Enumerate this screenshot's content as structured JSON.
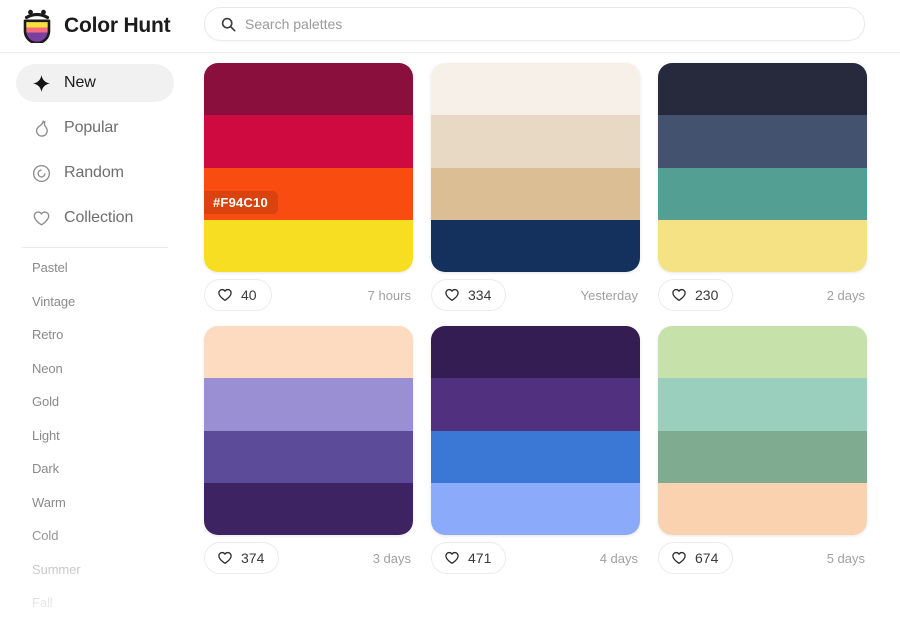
{
  "header": {
    "brand_name": "Color Hunt",
    "logo_icon": "colorhunt-logo-icon",
    "search": {
      "icon": "search-icon",
      "placeholder": "Search palettes",
      "value": ""
    }
  },
  "sidebar": {
    "nav": [
      {
        "label": "New",
        "icon": "sparkle-icon",
        "active": true
      },
      {
        "label": "Popular",
        "icon": "flame-icon",
        "active": false
      },
      {
        "label": "Random",
        "icon": "spiral-icon",
        "active": false
      },
      {
        "label": "Collection",
        "icon": "heart-icon",
        "active": false
      }
    ],
    "tags": [
      {
        "label": "Pastel"
      },
      {
        "label": "Vintage"
      },
      {
        "label": "Retro"
      },
      {
        "label": "Neon"
      },
      {
        "label": "Gold"
      },
      {
        "label": "Light"
      },
      {
        "label": "Dark"
      },
      {
        "label": "Warm"
      },
      {
        "label": "Cold"
      },
      {
        "label": "Summer"
      },
      {
        "label": "Fall"
      }
    ]
  },
  "palettes": [
    {
      "colors": [
        "#8A0F3C",
        "#CE0A41",
        "#F94C10",
        "#F8DE22"
      ],
      "hex_label": "#F94C10",
      "hex_label_band": 2,
      "likes": "40",
      "timestamp": "7 hours"
    },
    {
      "colors": [
        "#F7F0E8",
        "#E8D9C5",
        "#DCBE95",
        "#13315C"
      ],
      "hex_label": null,
      "hex_label_band": -1,
      "likes": "334",
      "timestamp": "Yesterday"
    },
    {
      "colors": [
        "#27293D",
        "#43526E",
        "#549F93",
        "#F4E285"
      ],
      "hex_label": null,
      "hex_label_band": -1,
      "likes": "230",
      "timestamp": "2 days"
    },
    {
      "colors": [
        "#FCDBC1",
        "#9B8FD4",
        "#5C4B99",
        "#3D2362"
      ],
      "hex_label": null,
      "hex_label_band": -1,
      "likes": "374",
      "timestamp": "3 days"
    },
    {
      "colors": [
        "#331D53",
        "#523080",
        "#3B77D4",
        "#8BABFA"
      ],
      "hex_label": null,
      "hex_label_band": -1,
      "likes": "471",
      "timestamp": "4 days"
    },
    {
      "colors": [
        "#C7E1AB",
        "#9ACFBD",
        "#7FAC90",
        "#FBD2AF"
      ],
      "hex_label": null,
      "hex_label_band": -1,
      "likes": "674",
      "timestamp": "5 days"
    }
  ]
}
